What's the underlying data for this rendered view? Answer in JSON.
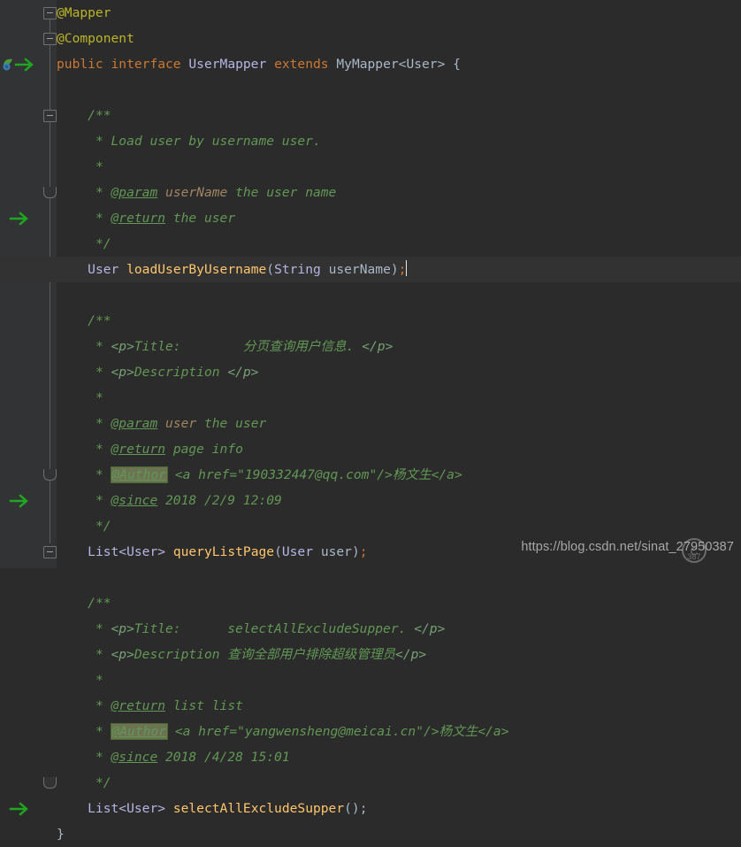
{
  "editor": {
    "background": "#2b2b2b",
    "gutter_background": "#313335",
    "current_line_background": "#323232",
    "colors": {
      "keyword": "#cc7832",
      "annotation": "#bbb529",
      "javadoc": "#629755",
      "javadoc_html_tag": "#77a177",
      "javadoc_param_value": "#a08562",
      "method": "#ffc66d",
      "identifier": "#a9b7c6",
      "interface_name": "#b5b6e3",
      "author_tag_highlight": "#6b7353",
      "gutter_arrow": "#1fa81f"
    },
    "caret_after_line_index": 8
  },
  "gutter": {
    "icons": [
      {
        "name": "mybatis-mapper-icon",
        "line": 2
      },
      {
        "name": "navigate-to-statement-arrow-icon",
        "line": 2
      },
      {
        "name": "navigate-to-statement-arrow-icon",
        "line": 8
      },
      {
        "name": "navigate-to-statement-arrow-icon",
        "line": 19
      },
      {
        "name": "navigate-to-statement-arrow-icon",
        "line": 31
      }
    ],
    "fold_markers": [
      {
        "line": 0,
        "type": "collapse"
      },
      {
        "line": 1,
        "type": "collapse"
      },
      {
        "line": 4,
        "type": "collapse"
      },
      {
        "line": 7,
        "type": "end"
      },
      {
        "line": 10,
        "type": "collapse"
      },
      {
        "line": 18,
        "type": "end"
      },
      {
        "line": 21,
        "type": "collapse"
      },
      {
        "line": 30,
        "type": "end"
      }
    ]
  },
  "code": {
    "lines": [
      {
        "index": 0,
        "indent": 0,
        "tokens": [
          {
            "t": "@Mapper",
            "c": "ann"
          }
        ]
      },
      {
        "index": 1,
        "indent": 0,
        "tokens": [
          {
            "t": "@Component",
            "c": "ann"
          }
        ]
      },
      {
        "index": 2,
        "indent": 0,
        "tokens": [
          {
            "t": "public",
            "c": "kw"
          },
          {
            "t": " ",
            "c": "plain"
          },
          {
            "t": "interface",
            "c": "kw"
          },
          {
            "t": " ",
            "c": "plain"
          },
          {
            "t": "UserMapper",
            "c": "ifc"
          },
          {
            "t": " ",
            "c": "plain"
          },
          {
            "t": "extends",
            "c": "kw"
          },
          {
            "t": " ",
            "c": "plain"
          },
          {
            "t": "MyMapper<User> {",
            "c": "cls"
          }
        ]
      },
      {
        "index": 3,
        "indent": 0,
        "tokens": []
      },
      {
        "index": 4,
        "indent": 4,
        "tokens": [
          {
            "t": "/**",
            "c": "doc"
          }
        ]
      },
      {
        "index": 5,
        "indent": 5,
        "tokens": [
          {
            "t": "* Load user by username user.",
            "c": "doc"
          }
        ]
      },
      {
        "index": 6,
        "indent": 5,
        "tokens": [
          {
            "t": "*",
            "c": "doc"
          }
        ]
      },
      {
        "index": 7,
        "indent": 5,
        "tokens": [
          {
            "t": "* ",
            "c": "doc"
          },
          {
            "t": "@param",
            "c": "doctag"
          },
          {
            "t": " ",
            "c": "doc"
          },
          {
            "t": "userName",
            "c": "docparam"
          },
          {
            "t": " the user name",
            "c": "doc"
          }
        ]
      },
      {
        "index": 8,
        "indent": 5,
        "tokens": [
          {
            "t": "* ",
            "c": "doc"
          },
          {
            "t": "@return",
            "c": "doctag"
          },
          {
            "t": " the user",
            "c": "doc"
          }
        ]
      },
      {
        "index": 9,
        "indent": 5,
        "tokens": [
          {
            "t": "*/",
            "c": "doc"
          }
        ]
      },
      {
        "index": 10,
        "indent": 4,
        "tokens": [
          {
            "t": "User",
            "c": "ifc"
          },
          {
            "t": " ",
            "c": "plain"
          },
          {
            "t": "loadUserByUsername",
            "c": "mth"
          },
          {
            "t": "(",
            "c": "plain"
          },
          {
            "t": "String",
            "c": "ifc"
          },
          {
            "t": " ",
            "c": "plain"
          },
          {
            "t": "userName",
            "c": "cls"
          },
          {
            "t": ")",
            "c": "plain"
          },
          {
            "t": ";",
            "c": "kw"
          }
        ],
        "current": true,
        "caret": true
      },
      {
        "index": 11,
        "indent": 0,
        "tokens": []
      },
      {
        "index": 12,
        "indent": 4,
        "tokens": [
          {
            "t": "/**",
            "c": "doc"
          }
        ]
      },
      {
        "index": 13,
        "indent": 5,
        "tokens": [
          {
            "t": "* ",
            "c": "doc"
          },
          {
            "t": "<p>",
            "c": "dochtml"
          },
          {
            "t": "Title:        分页查询用户信息. ",
            "c": "doc"
          },
          {
            "t": "</p>",
            "c": "dochtml"
          }
        ]
      },
      {
        "index": 14,
        "indent": 5,
        "tokens": [
          {
            "t": "* ",
            "c": "doc"
          },
          {
            "t": "<p>",
            "c": "dochtml"
          },
          {
            "t": "Description ",
            "c": "doc"
          },
          {
            "t": "</p>",
            "c": "dochtml"
          }
        ]
      },
      {
        "index": 15,
        "indent": 5,
        "tokens": [
          {
            "t": "*",
            "c": "doc"
          }
        ]
      },
      {
        "index": 16,
        "indent": 5,
        "tokens": [
          {
            "t": "* ",
            "c": "doc"
          },
          {
            "t": "@param",
            "c": "doctag"
          },
          {
            "t": " ",
            "c": "doc"
          },
          {
            "t": "user",
            "c": "docparam"
          },
          {
            "t": " the user",
            "c": "doc"
          }
        ]
      },
      {
        "index": 17,
        "indent": 5,
        "tokens": [
          {
            "t": "* ",
            "c": "doc"
          },
          {
            "t": "@return",
            "c": "doctag"
          },
          {
            "t": " page info",
            "c": "doc"
          }
        ]
      },
      {
        "index": 18,
        "indent": 5,
        "tokens": [
          {
            "t": "* ",
            "c": "doc"
          },
          {
            "t": "@Author",
            "c": "authorhl"
          },
          {
            "t": " <a href=\"190332447@qq.com\"/>杨文生</a>",
            "c": "doc"
          }
        ]
      },
      {
        "index": 19,
        "indent": 5,
        "tokens": [
          {
            "t": "* ",
            "c": "doc"
          },
          {
            "t": "@since",
            "c": "doctag"
          },
          {
            "t": " 2018 /2/9 12:09",
            "c": "doc"
          }
        ]
      },
      {
        "index": 20,
        "indent": 5,
        "tokens": [
          {
            "t": "*/",
            "c": "doc"
          }
        ]
      },
      {
        "index": 21,
        "indent": 4,
        "tokens": [
          {
            "t": "List<User>",
            "c": "ifc"
          },
          {
            "t": " ",
            "c": "plain"
          },
          {
            "t": "queryListPage",
            "c": "mth"
          },
          {
            "t": "(",
            "c": "plain"
          },
          {
            "t": "User",
            "c": "ifc"
          },
          {
            "t": " ",
            "c": "plain"
          },
          {
            "t": "user",
            "c": "cls"
          },
          {
            "t": ")",
            "c": "plain"
          },
          {
            "t": ";",
            "c": "kw"
          }
        ]
      },
      {
        "index": 22,
        "indent": 0,
        "tokens": []
      },
      {
        "index": 23,
        "indent": 4,
        "tokens": [
          {
            "t": "/**",
            "c": "doc"
          }
        ]
      },
      {
        "index": 24,
        "indent": 5,
        "tokens": [
          {
            "t": "* ",
            "c": "doc"
          },
          {
            "t": "<p>",
            "c": "dochtml"
          },
          {
            "t": "Title:      selectAllExcludeSupper. ",
            "c": "doc"
          },
          {
            "t": "</p>",
            "c": "dochtml"
          }
        ]
      },
      {
        "index": 25,
        "indent": 5,
        "tokens": [
          {
            "t": "* ",
            "c": "doc"
          },
          {
            "t": "<p>",
            "c": "dochtml"
          },
          {
            "t": "Description 查询全部用户排除超级管理员",
            "c": "doc"
          },
          {
            "t": "</p>",
            "c": "dochtml"
          }
        ]
      },
      {
        "index": 26,
        "indent": 5,
        "tokens": [
          {
            "t": "*",
            "c": "doc"
          }
        ]
      },
      {
        "index": 27,
        "indent": 5,
        "tokens": [
          {
            "t": "* ",
            "c": "doc"
          },
          {
            "t": "@return",
            "c": "doctag"
          },
          {
            "t": " list list",
            "c": "doc"
          }
        ]
      },
      {
        "index": 28,
        "indent": 5,
        "tokens": [
          {
            "t": "* ",
            "c": "doc"
          },
          {
            "t": "@Author",
            "c": "authorhl"
          },
          {
            "t": " <a href=\"yangwensheng@meicai.cn\"/>杨文生</a>",
            "c": "doc"
          }
        ]
      },
      {
        "index": 29,
        "indent": 5,
        "tokens": [
          {
            "t": "* ",
            "c": "doc"
          },
          {
            "t": "@since",
            "c": "doctag"
          },
          {
            "t": " 2018 /4/28 15:01",
            "c": "doc"
          }
        ]
      },
      {
        "index": 30,
        "indent": 5,
        "tokens": [
          {
            "t": "*/",
            "c": "doc"
          }
        ]
      },
      {
        "index": 31,
        "indent": 4,
        "tokens": [
          {
            "t": "List<User>",
            "c": "ifc"
          },
          {
            "t": " ",
            "c": "plain"
          },
          {
            "t": "selectAllExcludeSupper",
            "c": "mth"
          },
          {
            "t": "();",
            "c": "plain"
          }
        ]
      },
      {
        "index": 32,
        "indent": 0,
        "tokens": [
          {
            "t": "}",
            "c": "cls"
          }
        ]
      }
    ]
  },
  "watermark": {
    "url_text": "https://blog.csdn.net/sinat_27950387",
    "logo_name": "csdn-logo-watermark"
  }
}
